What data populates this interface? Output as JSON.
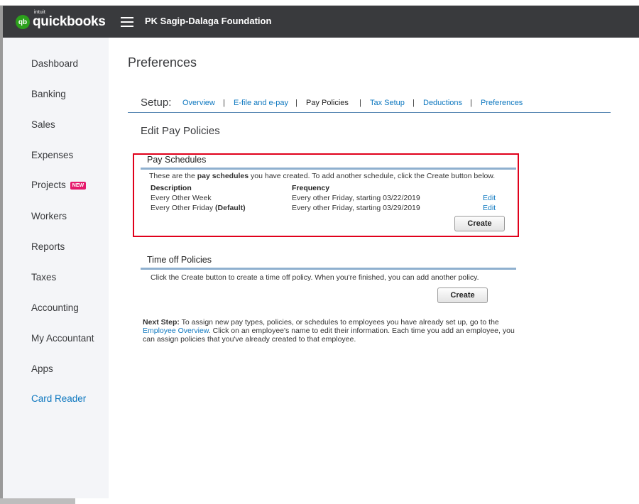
{
  "header": {
    "logo_badge": "qb",
    "logo_intuit": "intuit",
    "logo_text": "quickbooks",
    "company_name": "PK Sagip-Dalaga Foundation"
  },
  "sidebar": {
    "items": [
      {
        "label": "Dashboard"
      },
      {
        "label": "Banking"
      },
      {
        "label": "Sales"
      },
      {
        "label": "Expenses"
      },
      {
        "label": "Projects",
        "badge": "NEW"
      },
      {
        "label": "Workers"
      },
      {
        "label": "Reports"
      },
      {
        "label": "Taxes"
      },
      {
        "label": "Accounting"
      },
      {
        "label": "My Accountant"
      },
      {
        "label": "Apps"
      },
      {
        "label": "Card Reader"
      }
    ]
  },
  "main": {
    "page_title": "Preferences",
    "setup_label": "Setup:",
    "tabs": [
      {
        "label": "Overview"
      },
      {
        "label": "E-file and e-pay"
      },
      {
        "label": "Pay Policies"
      },
      {
        "label": "Tax Setup"
      },
      {
        "label": "Deductions"
      },
      {
        "label": "Preferences"
      }
    ],
    "separator": "|",
    "section_title": "Edit Pay Policies",
    "pay_schedules": {
      "title": "Pay Schedules",
      "intro_before": "These are the ",
      "intro_bold": "pay schedules",
      "intro_after": " you have created. To add another schedule, click the Create button below.",
      "col_description": "Description",
      "col_frequency": "Frequency",
      "rows": [
        {
          "description": "Every Other Week",
          "default_tag": "",
          "frequency": "Every other Friday, starting 03/22/2019",
          "edit": "Edit"
        },
        {
          "description": "Every Other Friday ",
          "default_tag": "(Default)",
          "frequency": "Every other Friday, starting 03/29/2019",
          "edit": "Edit"
        }
      ],
      "create_label": "Create"
    },
    "time_off": {
      "title": "Time off Policies",
      "intro": "Click the Create button to create a time off policy. When you're finished, you can add another policy.",
      "create_label": "Create"
    },
    "next_step": {
      "label": "Next Step:",
      "text_before": " To assign new pay types, policies, or schedules to employees you have already set up, go to the ",
      "link": "Employee Overview",
      "text_after": ". Click on an employee's name to edit their information. Each time you add an employee, you can assign policies that you've already created to that employee."
    }
  },
  "colors": {
    "header_bg": "#393a3d",
    "sidebar_bg": "#f4f5f8",
    "link": "#0d77bf",
    "highlight_box": "#e0001b",
    "brand_green": "#2ca01c",
    "new_badge": "#e5186b"
  }
}
